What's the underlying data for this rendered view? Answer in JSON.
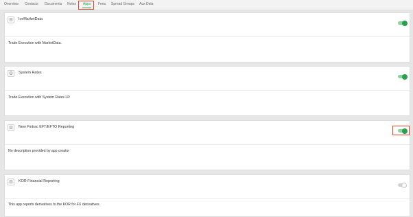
{
  "tabs": [
    {
      "label": "Overview"
    },
    {
      "label": "Contacts"
    },
    {
      "label": "Documents"
    },
    {
      "label": "Notes"
    },
    {
      "label": "Apps"
    },
    {
      "label": "Fees"
    },
    {
      "label": "Spread Groups"
    },
    {
      "label": "Aux Data"
    }
  ],
  "active_tab": "Apps",
  "apps": [
    {
      "name": "IceMarketData",
      "description": "Trade Execution with MarketData.",
      "enabled": true
    },
    {
      "name": "System Rates",
      "description": "Trade Execution with System Rates LP.",
      "enabled": true
    },
    {
      "name": "New Fintrac EFT/EFTO Reporting",
      "description": "No description provided by app creator",
      "enabled": true,
      "highlighted": true
    },
    {
      "name": "KOR Financial Reporting",
      "description": "This app reports derivatives to the KOR for FX derivatives.",
      "enabled": false
    }
  ],
  "icons": {
    "settings": "gear-icon"
  },
  "colors": {
    "accent": "#2e9e4f",
    "toggle_on_track": "#8fd1a0",
    "highlight": "#e0412c"
  }
}
